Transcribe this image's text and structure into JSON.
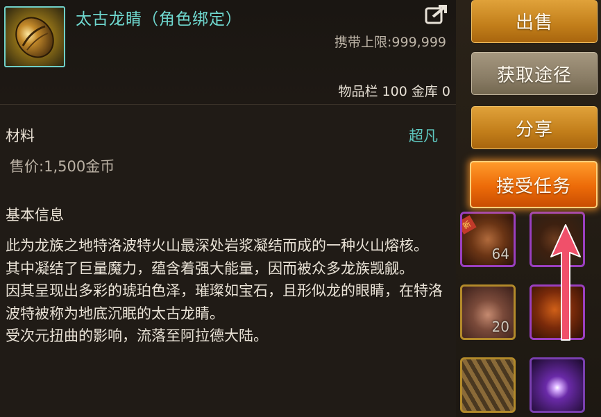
{
  "item": {
    "name": "太古龙睛（角色绑定）",
    "carry_limit_label": "携带上限:",
    "carry_limit_value": "999,999",
    "bag_label": "物品栏",
    "bag_count": "100",
    "vault_label": "金库",
    "vault_count": "0",
    "category": "材料",
    "rarity": "超凡",
    "price_label": "售价:",
    "price_value": "1,500金币",
    "info_heading": "基本信息",
    "description": [
      "此为龙族之地特洛波特火山最深处岩浆凝结而成的一种火山熔核。",
      "其中凝结了巨量魔力，蕴含着强大能量，因而被众多龙族觊觎。",
      "因其呈现出多彩的琥珀色泽，璀璨如宝石，且形似龙的眼睛，在特洛波特被称为地底沉眠的太古龙睛。",
      "受次元扭曲的影响，流落至阿拉德大陆。"
    ]
  },
  "actions": {
    "sell": "出售",
    "obtain": "获取途径",
    "share": "分享",
    "accept_quest": "接受任务"
  },
  "inventory": {
    "slot_counts": [
      "64",
      "20"
    ]
  },
  "colors": {
    "item_name": "#6fd8cf",
    "rarity": "#5ec8c0",
    "button_gold": "#c27e1a",
    "button_gray": "#8a7d66",
    "button_highlight": "#ec6a08",
    "arrow": "#f0506a"
  },
  "icons": {
    "item": "amber-dragon-eye-icon",
    "share": "external-share-icon",
    "annotation": "up-arrow-annotation"
  }
}
